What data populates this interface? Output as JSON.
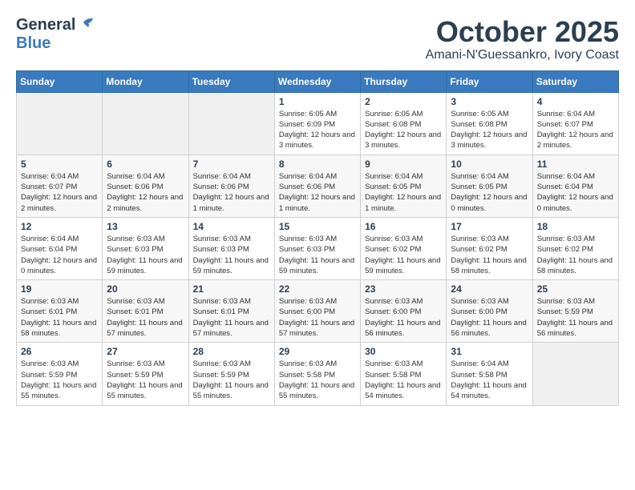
{
  "header": {
    "logo": {
      "general": "General",
      "blue": "Blue"
    },
    "title": "October 2025",
    "location": "Amani-N'Guessankro, Ivory Coast"
  },
  "weekdays": [
    "Sunday",
    "Monday",
    "Tuesday",
    "Wednesday",
    "Thursday",
    "Friday",
    "Saturday"
  ],
  "weeks": [
    [
      {
        "day": "",
        "info": ""
      },
      {
        "day": "",
        "info": ""
      },
      {
        "day": "",
        "info": ""
      },
      {
        "day": "1",
        "sunrise": "6:05 AM",
        "sunset": "6:09 PM",
        "daylight": "12 hours and 3 minutes."
      },
      {
        "day": "2",
        "sunrise": "6:05 AM",
        "sunset": "6:08 PM",
        "daylight": "12 hours and 3 minutes."
      },
      {
        "day": "3",
        "sunrise": "6:05 AM",
        "sunset": "6:08 PM",
        "daylight": "12 hours and 3 minutes."
      },
      {
        "day": "4",
        "sunrise": "6:04 AM",
        "sunset": "6:07 PM",
        "daylight": "12 hours and 2 minutes."
      }
    ],
    [
      {
        "day": "5",
        "sunrise": "6:04 AM",
        "sunset": "6:07 PM",
        "daylight": "12 hours and 2 minutes."
      },
      {
        "day": "6",
        "sunrise": "6:04 AM",
        "sunset": "6:06 PM",
        "daylight": "12 hours and 2 minutes."
      },
      {
        "day": "7",
        "sunrise": "6:04 AM",
        "sunset": "6:06 PM",
        "daylight": "12 hours and 1 minute."
      },
      {
        "day": "8",
        "sunrise": "6:04 AM",
        "sunset": "6:06 PM",
        "daylight": "12 hours and 1 minute."
      },
      {
        "day": "9",
        "sunrise": "6:04 AM",
        "sunset": "6:05 PM",
        "daylight": "12 hours and 1 minute."
      },
      {
        "day": "10",
        "sunrise": "6:04 AM",
        "sunset": "6:05 PM",
        "daylight": "12 hours and 0 minutes."
      },
      {
        "day": "11",
        "sunrise": "6:04 AM",
        "sunset": "6:04 PM",
        "daylight": "12 hours and 0 minutes."
      }
    ],
    [
      {
        "day": "12",
        "sunrise": "6:04 AM",
        "sunset": "6:04 PM",
        "daylight": "12 hours and 0 minutes."
      },
      {
        "day": "13",
        "sunrise": "6:03 AM",
        "sunset": "6:03 PM",
        "daylight": "11 hours and 59 minutes."
      },
      {
        "day": "14",
        "sunrise": "6:03 AM",
        "sunset": "6:03 PM",
        "daylight": "11 hours and 59 minutes."
      },
      {
        "day": "15",
        "sunrise": "6:03 AM",
        "sunset": "6:03 PM",
        "daylight": "11 hours and 59 minutes."
      },
      {
        "day": "16",
        "sunrise": "6:03 AM",
        "sunset": "6:02 PM",
        "daylight": "11 hours and 59 minutes."
      },
      {
        "day": "17",
        "sunrise": "6:03 AM",
        "sunset": "6:02 PM",
        "daylight": "11 hours and 58 minutes."
      },
      {
        "day": "18",
        "sunrise": "6:03 AM",
        "sunset": "6:02 PM",
        "daylight": "11 hours and 58 minutes."
      }
    ],
    [
      {
        "day": "19",
        "sunrise": "6:03 AM",
        "sunset": "6:01 PM",
        "daylight": "11 hours and 58 minutes."
      },
      {
        "day": "20",
        "sunrise": "6:03 AM",
        "sunset": "6:01 PM",
        "daylight": "11 hours and 57 minutes."
      },
      {
        "day": "21",
        "sunrise": "6:03 AM",
        "sunset": "6:01 PM",
        "daylight": "11 hours and 57 minutes."
      },
      {
        "day": "22",
        "sunrise": "6:03 AM",
        "sunset": "6:00 PM",
        "daylight": "11 hours and 57 minutes."
      },
      {
        "day": "23",
        "sunrise": "6:03 AM",
        "sunset": "6:00 PM",
        "daylight": "11 hours and 56 minutes."
      },
      {
        "day": "24",
        "sunrise": "6:03 AM",
        "sunset": "6:00 PM",
        "daylight": "11 hours and 56 minutes."
      },
      {
        "day": "25",
        "sunrise": "6:03 AM",
        "sunset": "5:59 PM",
        "daylight": "11 hours and 56 minutes."
      }
    ],
    [
      {
        "day": "26",
        "sunrise": "6:03 AM",
        "sunset": "5:59 PM",
        "daylight": "11 hours and 55 minutes."
      },
      {
        "day": "27",
        "sunrise": "6:03 AM",
        "sunset": "5:59 PM",
        "daylight": "11 hours and 55 minutes."
      },
      {
        "day": "28",
        "sunrise": "6:03 AM",
        "sunset": "5:59 PM",
        "daylight": "11 hours and 55 minutes."
      },
      {
        "day": "29",
        "sunrise": "6:03 AM",
        "sunset": "5:58 PM",
        "daylight": "11 hours and 55 minutes."
      },
      {
        "day": "30",
        "sunrise": "6:03 AM",
        "sunset": "5:58 PM",
        "daylight": "11 hours and 54 minutes."
      },
      {
        "day": "31",
        "sunrise": "6:04 AM",
        "sunset": "5:58 PM",
        "daylight": "11 hours and 54 minutes."
      },
      {
        "day": "",
        "info": ""
      }
    ]
  ],
  "labels": {
    "sunrise_prefix": "Sunrise: ",
    "sunset_prefix": "Sunset: ",
    "daylight_prefix": "Daylight: "
  }
}
